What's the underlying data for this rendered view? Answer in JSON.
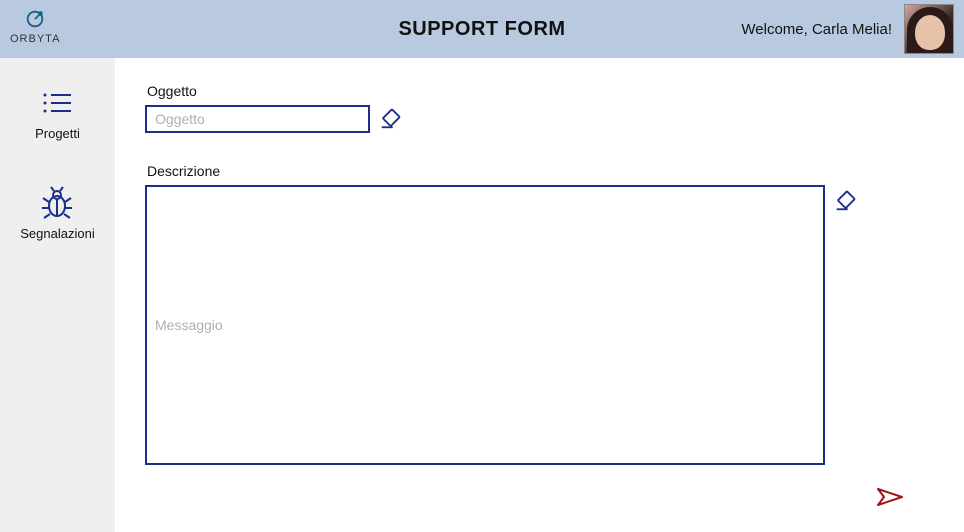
{
  "header": {
    "logo_text": "ORBYTA",
    "title": "SUPPORT FORM",
    "welcome": "Welcome, Carla Melia!"
  },
  "sidebar": {
    "items": [
      {
        "label": "Progetti"
      },
      {
        "label": "Segnalazioni"
      }
    ]
  },
  "form": {
    "subject_label": "Oggetto",
    "subject_placeholder": "Oggetto",
    "subject_value": "",
    "description_label": "Descrizione",
    "description_placeholder": "Messaggio",
    "description_value": ""
  },
  "colors": {
    "header_bg": "#b9cae0",
    "sidebar_bg": "#efefef",
    "primary": "#1b2e8a",
    "accent_red": "#a01414"
  }
}
